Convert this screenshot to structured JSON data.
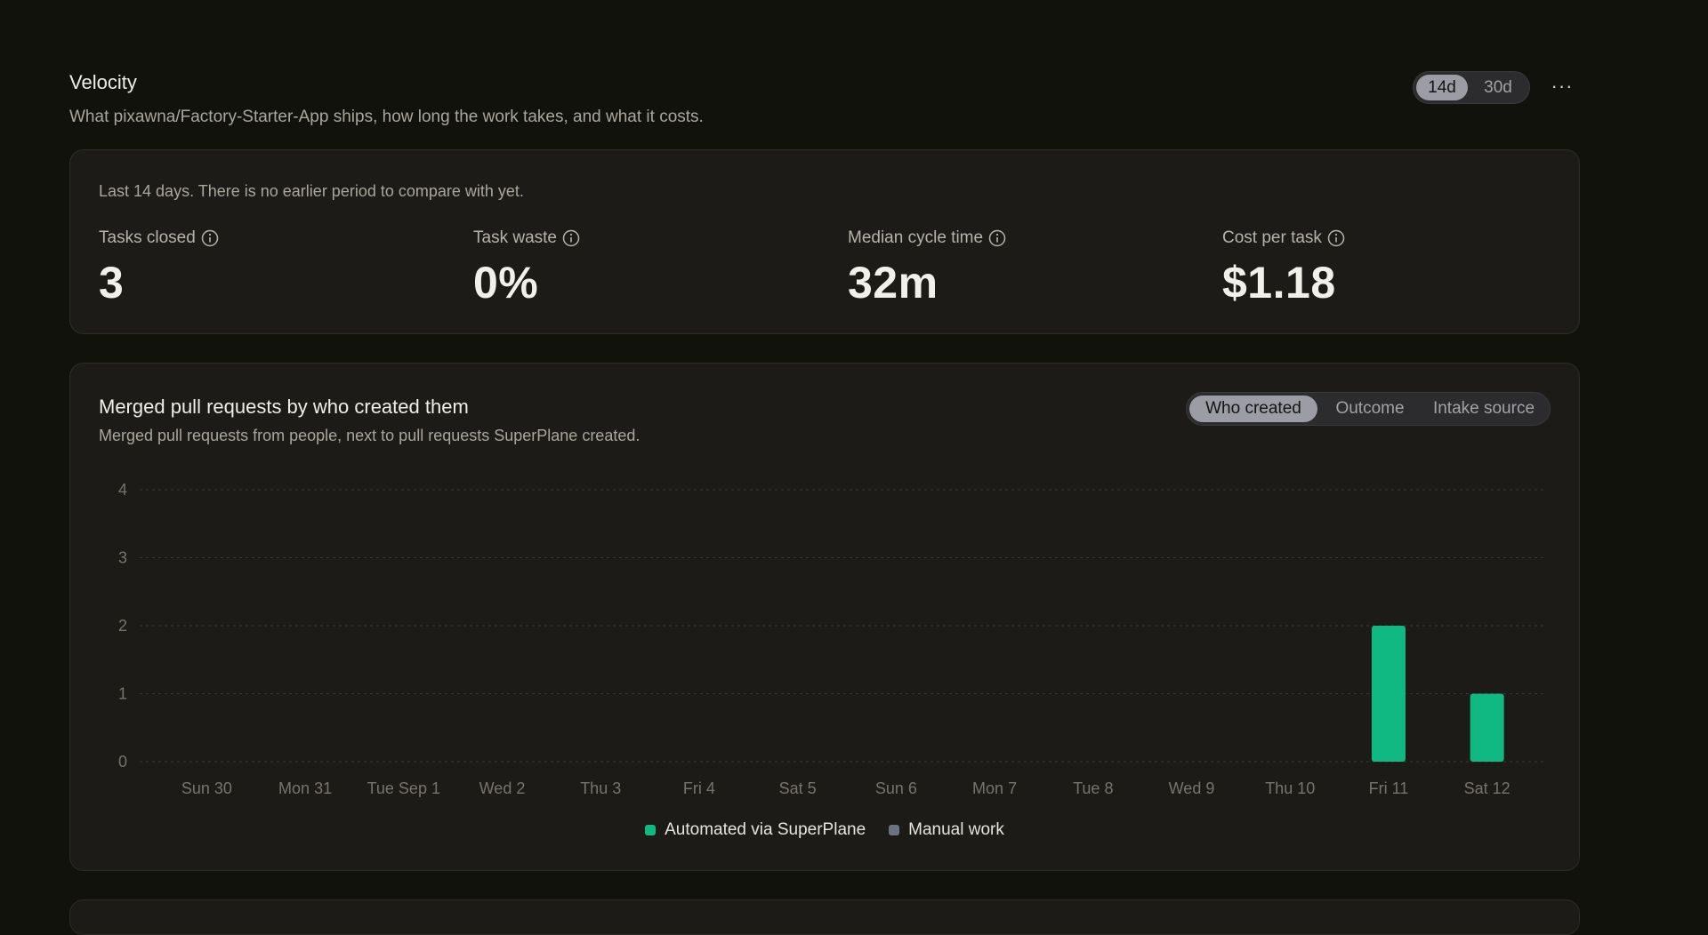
{
  "page": {
    "title": "Velocity",
    "subtitle": "What pixawna/Factory-Starter-App ships, how long the work takes, and what it costs."
  },
  "range_toggle": {
    "options": [
      "14d",
      "30d"
    ],
    "selected": "14d"
  },
  "more_button": {
    "label": "···"
  },
  "stats": {
    "period_note": "Last 14 days. There is no earlier period to compare with yet.",
    "metrics": [
      {
        "label": "Tasks closed",
        "value": "3"
      },
      {
        "label": "Task waste",
        "value": "0%"
      },
      {
        "label": "Median cycle time",
        "value": "32m"
      },
      {
        "label": "Cost per task",
        "value": "$1.18"
      }
    ]
  },
  "chart_card": {
    "title": "Merged pull requests by who created them",
    "subtitle": "Merged pull requests from people, next to pull requests SuperPlane created.",
    "view_toggle": {
      "options": [
        "Who created",
        "Outcome",
        "Intake source"
      ],
      "selected": "Who created"
    }
  },
  "colors": {
    "automated": "#10b981",
    "manual": "#6b7280",
    "grid": "#3a3832"
  },
  "icons": {
    "info": "info-circle-icon",
    "more": "more-horizontal-icon"
  },
  "chart_data": {
    "type": "bar",
    "stacked": true,
    "categories": [
      "Sun 30",
      "Mon 31",
      "Tue Sep 1",
      "Wed 2",
      "Thu 3",
      "Fri 4",
      "Sat 5",
      "Sun 6",
      "Mon 7",
      "Tue 8",
      "Wed 9",
      "Thu 10",
      "Fri 11",
      "Sat 12"
    ],
    "series": [
      {
        "name": "Automated via SuperPlane",
        "values": [
          0,
          0,
          0,
          0,
          0,
          0,
          0,
          0,
          0,
          0,
          0,
          0,
          2,
          1
        ]
      },
      {
        "name": "Manual work",
        "values": [
          0,
          0,
          0,
          0,
          0,
          0,
          0,
          0,
          0,
          0,
          0,
          0,
          0,
          0
        ]
      }
    ],
    "yticks": [
      0,
      1,
      2,
      3,
      4
    ],
    "ylim": [
      0,
      4
    ],
    "grid": true,
    "legend_position": "bottom-center"
  }
}
